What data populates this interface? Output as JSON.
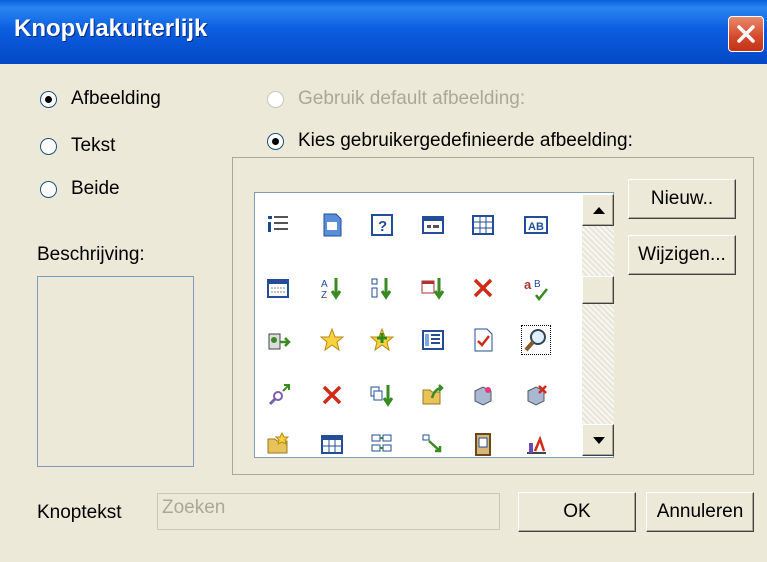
{
  "window": {
    "title": "Knopvlakuiterlijk"
  },
  "options": {
    "afbeelding": "Afbeelding",
    "tekst": "Tekst",
    "beide": "Beide",
    "default_afbeelding": "Gebruik default afbeelding:",
    "custom_afbeelding": "Kies gebruikergedefinieerde afbeelding:"
  },
  "beschrijving_label": "Beschrijving:",
  "buttons": {
    "nieuw": "Nieuw..",
    "wijzigen": "Wijzigen...",
    "ok": "OK",
    "annuleren": "Annuleren"
  },
  "knoptekst": {
    "label": "Knoptekst",
    "value": "Zoeken"
  },
  "icons": [
    "indent-icon",
    "document-icon",
    "help-icon",
    "form-icon",
    "grid-icon",
    "textbox-icon",
    "calendar-icon",
    "sort-az-icon",
    "sort-descending-icon",
    "date-sort-icon",
    "delete-icon",
    "spelling-icon",
    "export-icon",
    "star-icon",
    "star-add-icon",
    "list-view-icon",
    "checked-document-icon",
    "search-icon",
    "link-icon",
    "delete-icon",
    "copy-sort-icon",
    "open-folder-icon",
    "cube-icon",
    "cube-delete-icon",
    "folder-star-icon",
    "table-icon",
    "move-icon",
    "arrow-sort-icon",
    "door-icon",
    "chart-icon"
  ]
}
